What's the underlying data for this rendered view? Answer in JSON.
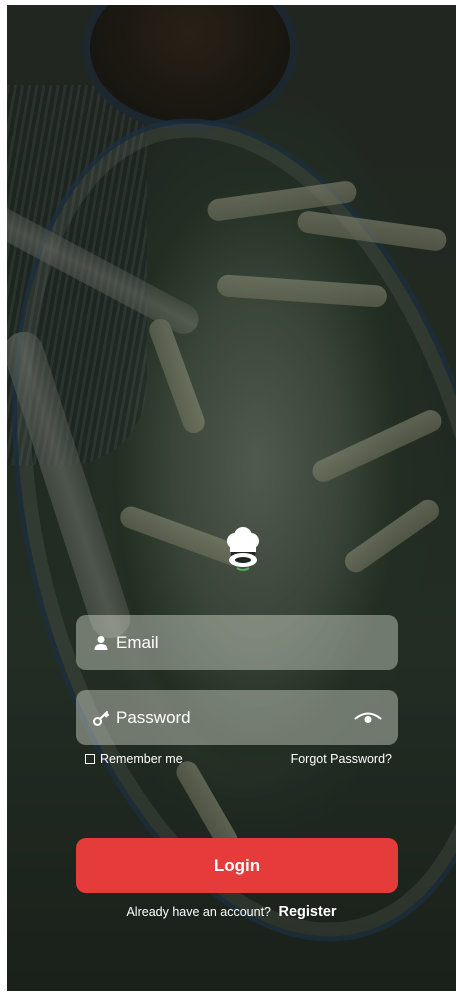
{
  "login_form": {
    "email_placeholder": "Email",
    "password_placeholder": "Password",
    "remember_label": "Remember me",
    "forgot_label": "Forgot Password?",
    "login_label": "Login",
    "register_prompt": "Already have an account?",
    "register_label": "Register"
  },
  "icons": {
    "logo": "chef-hat-logo-icon",
    "email": "user-icon",
    "password": "key-icon",
    "visibility": "eye-icon",
    "checkbox": "checkbox-icon"
  },
  "colors": {
    "accent": "#e53b3a",
    "text": "#ffffff"
  }
}
